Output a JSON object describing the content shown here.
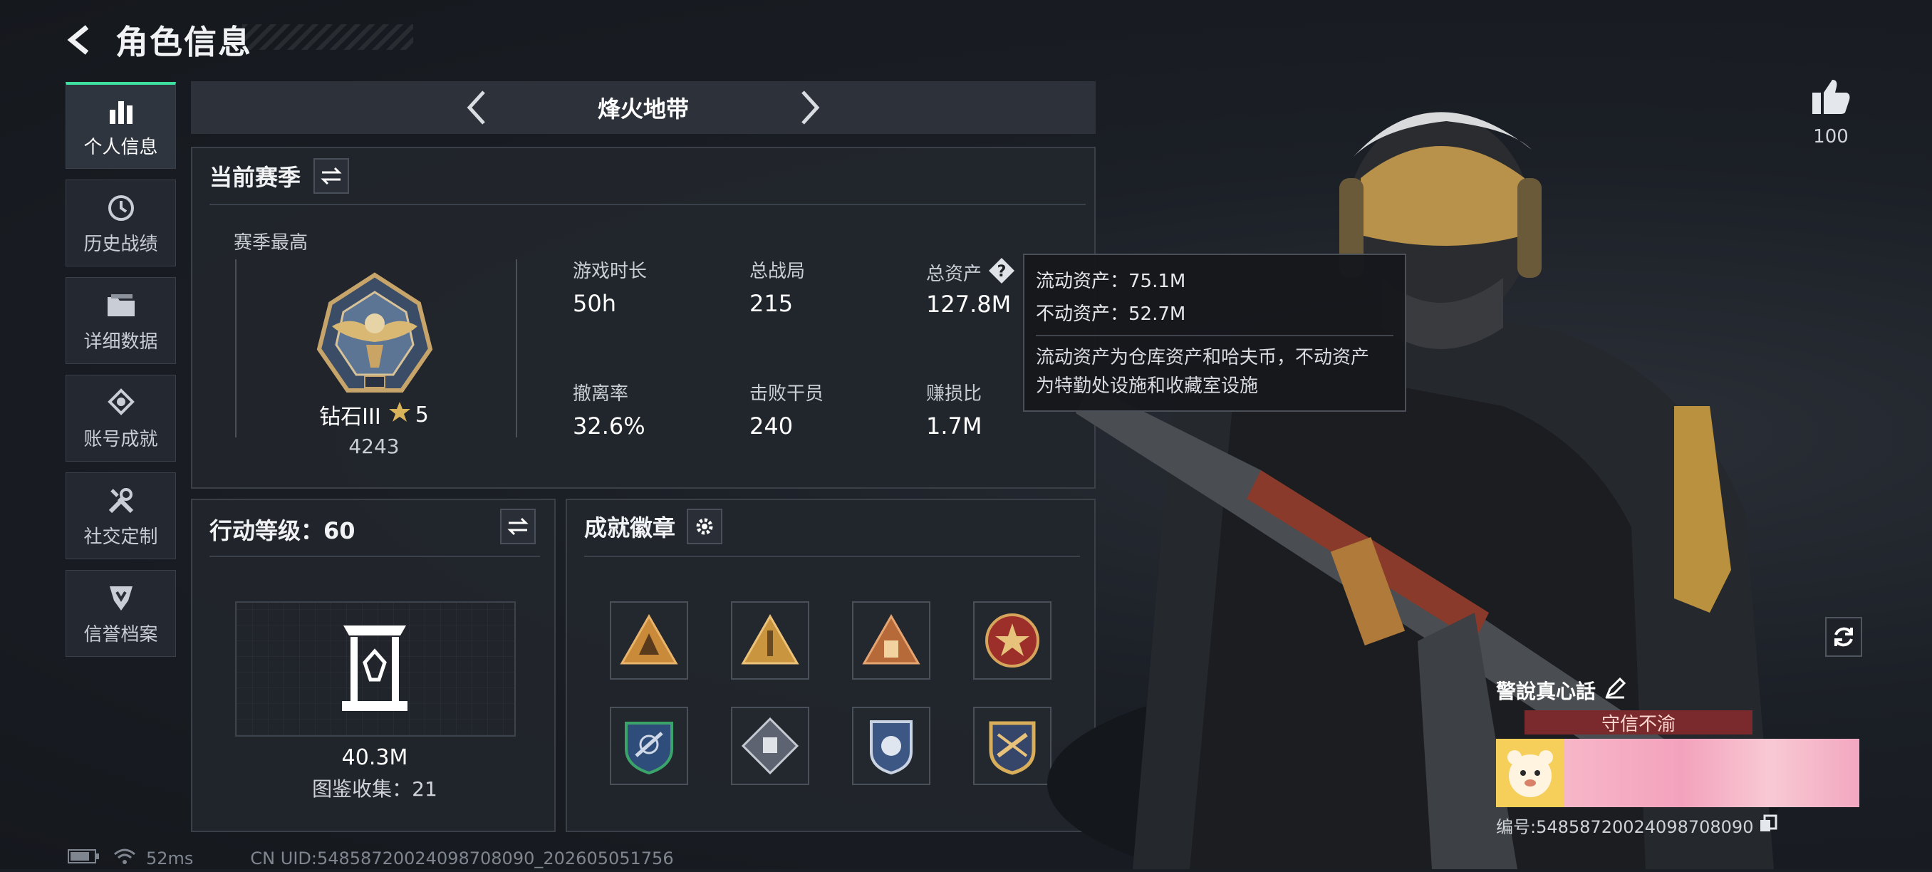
{
  "header": {
    "title": "角色信息"
  },
  "sidebar": {
    "items": [
      {
        "label": "个人信息",
        "icon": "bar-chart-icon",
        "active": true
      },
      {
        "label": "历史战绩",
        "icon": "history-icon"
      },
      {
        "label": "详细数据",
        "icon": "folder-icon"
      },
      {
        "label": "账号成就",
        "icon": "achievement-icon"
      },
      {
        "label": "社交定制",
        "icon": "wrench-icon"
      },
      {
        "label": "信誉档案",
        "icon": "shield-icon"
      }
    ]
  },
  "mode": {
    "title": "烽火地带"
  },
  "season": {
    "title": "当前赛季",
    "best_label": "赛季最高",
    "rank_name": "钻石III",
    "rank_stars": "5",
    "rank_score": "4243",
    "stats": [
      {
        "label": "游戏时长",
        "value": "50h"
      },
      {
        "label": "总战局",
        "value": "215"
      },
      {
        "label": "总资产",
        "value": "127.8M"
      },
      {
        "label": "撤离率",
        "value": "32.6%"
      },
      {
        "label": "击败干员",
        "value": "240"
      },
      {
        "label": "赚损比",
        "value": "1.7M"
      }
    ]
  },
  "tooltip": {
    "liquid": "流动资产：75.1M",
    "fixed": "不动资产：52.7M",
    "desc_line1": "流动资产为仓库资产和哈夫币，不动资产",
    "desc_line2": "为特勤处设施和收藏室设施"
  },
  "level": {
    "title": "行动等级：60",
    "value": "40.3M",
    "collection": "图鉴收集：21"
  },
  "achievements": {
    "title": "成就徽章",
    "badges": 8
  },
  "like": {
    "count": "100"
  },
  "namecard": {
    "name": "警說真心話",
    "motto": "守信不渝",
    "uid": "编号:548587200240987080​90"
  },
  "status": {
    "ping": "52ms",
    "uid": "CN UID:548587200240987080​90_202605051756"
  },
  "colors": {
    "accent": "#3ee0a0",
    "panel": "#22262d",
    "motto_bg": "#7a2a2c"
  }
}
